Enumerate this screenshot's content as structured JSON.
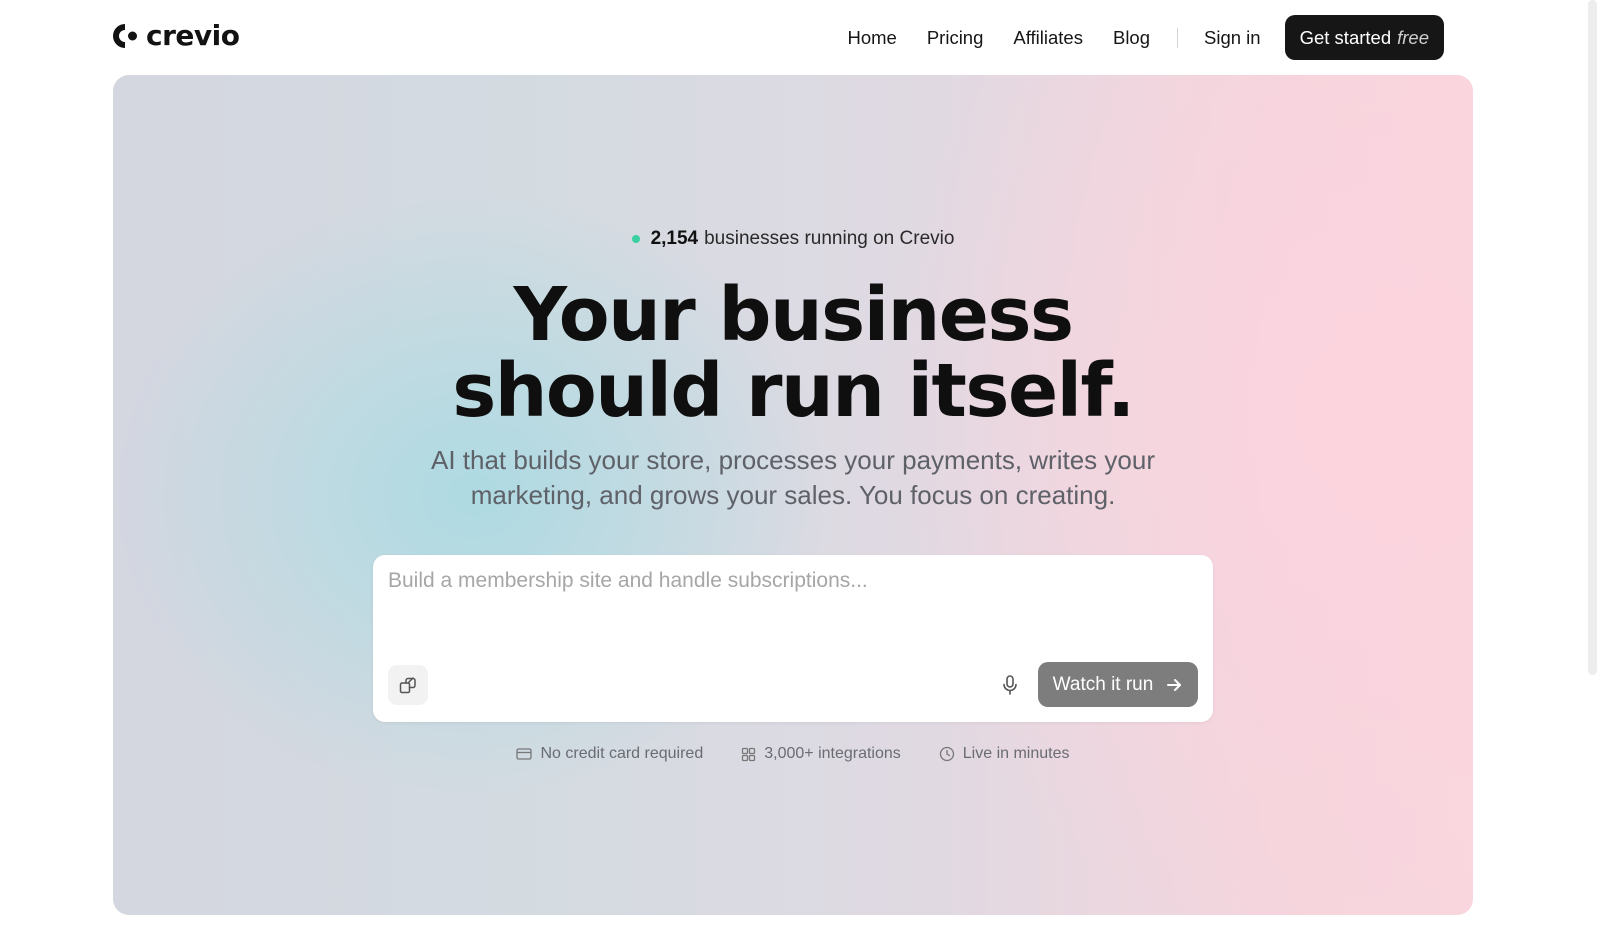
{
  "header": {
    "logo_text": "crevio",
    "nav": [
      "Home",
      "Pricing",
      "Affiliates",
      "Blog"
    ],
    "sign_in": "Sign in",
    "cta_label": "Get started",
    "cta_emphasis": "free"
  },
  "hero": {
    "stat_count": "2,154",
    "stat_text": "businesses running on Crevio",
    "headline_line1": "Your business",
    "headline_line2": "should run itself.",
    "subheadline": "AI that builds your store, processes your payments, writes your marketing, and grows your sales. You focus on creating.",
    "prompt": {
      "placeholder": "Build a membership site and handle subscriptions...",
      "value": "",
      "attach_icon": "attach-icon",
      "mic_icon": "microphone-icon",
      "submit_label": "Watch it run",
      "submit_icon": "arrow-right-icon"
    },
    "features": [
      {
        "icon": "credit-card-icon",
        "label": "No credit card required"
      },
      {
        "icon": "grid-icon",
        "label": "3,000+ integrations"
      },
      {
        "icon": "clock-icon",
        "label": "Live in minutes"
      }
    ]
  },
  "colors": {
    "accent_dot": "#3bd0a2",
    "cta_bg": "#161616",
    "submit_bg": "#7d7d7d"
  }
}
